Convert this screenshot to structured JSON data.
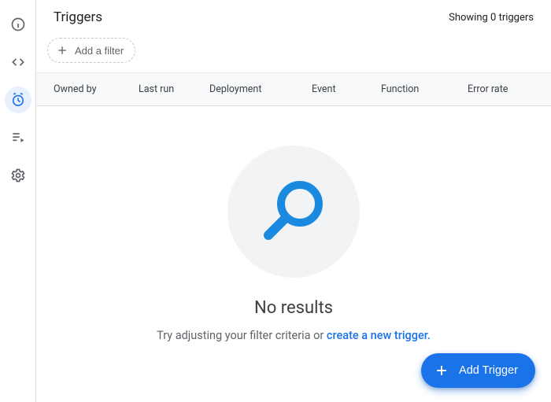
{
  "rail": {
    "items": [
      {
        "name": "info-icon"
      },
      {
        "name": "code-icon"
      },
      {
        "name": "clock-icon"
      },
      {
        "name": "list-play-icon"
      },
      {
        "name": "gear-icon"
      }
    ],
    "active_index": 2
  },
  "header": {
    "title": "Triggers",
    "counter": "Showing 0 triggers"
  },
  "filter": {
    "add_label": "Add a filter"
  },
  "columns": {
    "owned": "Owned by",
    "last_run": "Last run",
    "deployment": "Deployment",
    "event": "Event",
    "function": "Function",
    "error_rate": "Error rate"
  },
  "empty": {
    "title": "No results",
    "hint_prefix": "Try adjusting your filter criteria or ",
    "hint_link": "create a new trigger."
  },
  "fab": {
    "label": "Add Trigger"
  }
}
